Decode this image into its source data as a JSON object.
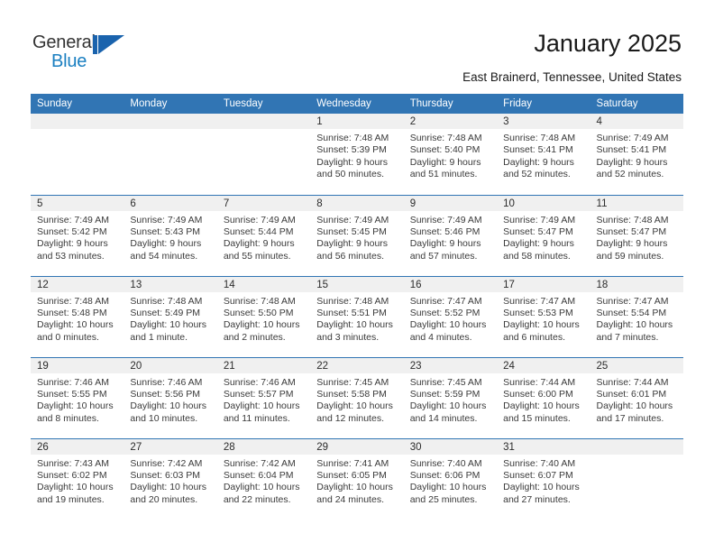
{
  "logo": {
    "text_top": "General",
    "text_bottom": "Blue",
    "mark": "blue-triangle-mark"
  },
  "header": {
    "title": "January 2025",
    "subtitle": "East Brainerd, Tennessee, United States"
  },
  "colors": {
    "header_blue": "#3175b4",
    "daynum_band": "#f0f0f0",
    "logo_blue": "#1a7fc1",
    "logo_mark_blue": "#1a63ad",
    "text": "#3a3a3a"
  },
  "calendar": {
    "weekday_headers": [
      "Sunday",
      "Monday",
      "Tuesday",
      "Wednesday",
      "Thursday",
      "Friday",
      "Saturday"
    ],
    "weeks": [
      [
        {
          "day": "",
          "lines": []
        },
        {
          "day": "",
          "lines": []
        },
        {
          "day": "",
          "lines": []
        },
        {
          "day": "1",
          "lines": [
            "Sunrise: 7:48 AM",
            "Sunset: 5:39 PM",
            "Daylight: 9 hours",
            "and 50 minutes."
          ]
        },
        {
          "day": "2",
          "lines": [
            "Sunrise: 7:48 AM",
            "Sunset: 5:40 PM",
            "Daylight: 9 hours",
            "and 51 minutes."
          ]
        },
        {
          "day": "3",
          "lines": [
            "Sunrise: 7:48 AM",
            "Sunset: 5:41 PM",
            "Daylight: 9 hours",
            "and 52 minutes."
          ]
        },
        {
          "day": "4",
          "lines": [
            "Sunrise: 7:49 AM",
            "Sunset: 5:41 PM",
            "Daylight: 9 hours",
            "and 52 minutes."
          ]
        }
      ],
      [
        {
          "day": "5",
          "lines": [
            "Sunrise: 7:49 AM",
            "Sunset: 5:42 PM",
            "Daylight: 9 hours",
            "and 53 minutes."
          ]
        },
        {
          "day": "6",
          "lines": [
            "Sunrise: 7:49 AM",
            "Sunset: 5:43 PM",
            "Daylight: 9 hours",
            "and 54 minutes."
          ]
        },
        {
          "day": "7",
          "lines": [
            "Sunrise: 7:49 AM",
            "Sunset: 5:44 PM",
            "Daylight: 9 hours",
            "and 55 minutes."
          ]
        },
        {
          "day": "8",
          "lines": [
            "Sunrise: 7:49 AM",
            "Sunset: 5:45 PM",
            "Daylight: 9 hours",
            "and 56 minutes."
          ]
        },
        {
          "day": "9",
          "lines": [
            "Sunrise: 7:49 AM",
            "Sunset: 5:46 PM",
            "Daylight: 9 hours",
            "and 57 minutes."
          ]
        },
        {
          "day": "10",
          "lines": [
            "Sunrise: 7:49 AM",
            "Sunset: 5:47 PM",
            "Daylight: 9 hours",
            "and 58 minutes."
          ]
        },
        {
          "day": "11",
          "lines": [
            "Sunrise: 7:48 AM",
            "Sunset: 5:47 PM",
            "Daylight: 9 hours",
            "and 59 minutes."
          ]
        }
      ],
      [
        {
          "day": "12",
          "lines": [
            "Sunrise: 7:48 AM",
            "Sunset: 5:48 PM",
            "Daylight: 10 hours",
            "and 0 minutes."
          ]
        },
        {
          "day": "13",
          "lines": [
            "Sunrise: 7:48 AM",
            "Sunset: 5:49 PM",
            "Daylight: 10 hours",
            "and 1 minute."
          ]
        },
        {
          "day": "14",
          "lines": [
            "Sunrise: 7:48 AM",
            "Sunset: 5:50 PM",
            "Daylight: 10 hours",
            "and 2 minutes."
          ]
        },
        {
          "day": "15",
          "lines": [
            "Sunrise: 7:48 AM",
            "Sunset: 5:51 PM",
            "Daylight: 10 hours",
            "and 3 minutes."
          ]
        },
        {
          "day": "16",
          "lines": [
            "Sunrise: 7:47 AM",
            "Sunset: 5:52 PM",
            "Daylight: 10 hours",
            "and 4 minutes."
          ]
        },
        {
          "day": "17",
          "lines": [
            "Sunrise: 7:47 AM",
            "Sunset: 5:53 PM",
            "Daylight: 10 hours",
            "and 6 minutes."
          ]
        },
        {
          "day": "18",
          "lines": [
            "Sunrise: 7:47 AM",
            "Sunset: 5:54 PM",
            "Daylight: 10 hours",
            "and 7 minutes."
          ]
        }
      ],
      [
        {
          "day": "19",
          "lines": [
            "Sunrise: 7:46 AM",
            "Sunset: 5:55 PM",
            "Daylight: 10 hours",
            "and 8 minutes."
          ]
        },
        {
          "day": "20",
          "lines": [
            "Sunrise: 7:46 AM",
            "Sunset: 5:56 PM",
            "Daylight: 10 hours",
            "and 10 minutes."
          ]
        },
        {
          "day": "21",
          "lines": [
            "Sunrise: 7:46 AM",
            "Sunset: 5:57 PM",
            "Daylight: 10 hours",
            "and 11 minutes."
          ]
        },
        {
          "day": "22",
          "lines": [
            "Sunrise: 7:45 AM",
            "Sunset: 5:58 PM",
            "Daylight: 10 hours",
            "and 12 minutes."
          ]
        },
        {
          "day": "23",
          "lines": [
            "Sunrise: 7:45 AM",
            "Sunset: 5:59 PM",
            "Daylight: 10 hours",
            "and 14 minutes."
          ]
        },
        {
          "day": "24",
          "lines": [
            "Sunrise: 7:44 AM",
            "Sunset: 6:00 PM",
            "Daylight: 10 hours",
            "and 15 minutes."
          ]
        },
        {
          "day": "25",
          "lines": [
            "Sunrise: 7:44 AM",
            "Sunset: 6:01 PM",
            "Daylight: 10 hours",
            "and 17 minutes."
          ]
        }
      ],
      [
        {
          "day": "26",
          "lines": [
            "Sunrise: 7:43 AM",
            "Sunset: 6:02 PM",
            "Daylight: 10 hours",
            "and 19 minutes."
          ]
        },
        {
          "day": "27",
          "lines": [
            "Sunrise: 7:42 AM",
            "Sunset: 6:03 PM",
            "Daylight: 10 hours",
            "and 20 minutes."
          ]
        },
        {
          "day": "28",
          "lines": [
            "Sunrise: 7:42 AM",
            "Sunset: 6:04 PM",
            "Daylight: 10 hours",
            "and 22 minutes."
          ]
        },
        {
          "day": "29",
          "lines": [
            "Sunrise: 7:41 AM",
            "Sunset: 6:05 PM",
            "Daylight: 10 hours",
            "and 24 minutes."
          ]
        },
        {
          "day": "30",
          "lines": [
            "Sunrise: 7:40 AM",
            "Sunset: 6:06 PM",
            "Daylight: 10 hours",
            "and 25 minutes."
          ]
        },
        {
          "day": "31",
          "lines": [
            "Sunrise: 7:40 AM",
            "Sunset: 6:07 PM",
            "Daylight: 10 hours",
            "and 27 minutes."
          ]
        },
        {
          "day": "",
          "lines": []
        }
      ]
    ]
  }
}
